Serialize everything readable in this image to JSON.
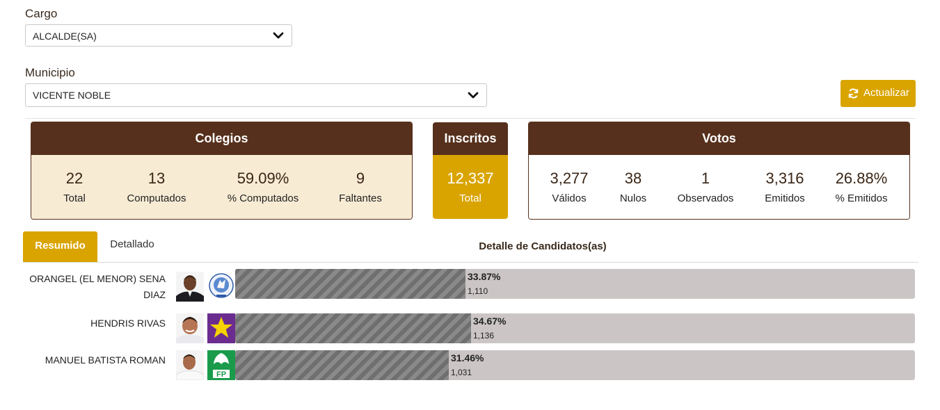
{
  "filters": {
    "cargo_label": "Cargo",
    "cargo_value": "ALCALDE(SA)",
    "municipio_label": "Municipio",
    "municipio_value": "VICENTE NOBLE",
    "refresh_label": "Actualizar"
  },
  "colegios": {
    "title": "Colegios",
    "stats": [
      {
        "value": "22",
        "caption": "Total"
      },
      {
        "value": "13",
        "caption": "Computados"
      },
      {
        "value": "59.09%",
        "caption": "% Computados"
      },
      {
        "value": "9",
        "caption": "Faltantes"
      }
    ]
  },
  "inscritos": {
    "title": "Inscritos",
    "value": "12,337",
    "caption": "Total"
  },
  "votos": {
    "title": "Votos",
    "stats": [
      {
        "value": "3,277",
        "caption": "Válidos"
      },
      {
        "value": "38",
        "caption": "Nulos"
      },
      {
        "value": "1",
        "caption": "Observados"
      },
      {
        "value": "3,316",
        "caption": "Emitidos"
      },
      {
        "value": "26.88%",
        "caption": "% Emitidos"
      }
    ]
  },
  "tabs": {
    "resumen": "Resumido",
    "detallado": "Detallado",
    "title": "Detalle de Candidatos(as)"
  },
  "candidates": [
    {
      "name_line1": "ORANGEL (EL MENOR) SENA",
      "name_line2": "DIAZ",
      "percent_label": "33.87%",
      "percent": 33.87,
      "votes": "1,110"
    },
    {
      "name_line1": "HENDRIS RIVAS",
      "name_line2": "",
      "percent_label": "34.67%",
      "percent": 34.67,
      "votes": "1,136"
    },
    {
      "name_line1": "MANUEL BATISTA ROMAN",
      "name_line2": "",
      "percent_label": "31.46%",
      "percent": 31.46,
      "votes": "1,031"
    }
  ],
  "colors": {
    "brown": "#56301c",
    "gold": "#d9a400",
    "bar_bg": "#cbc6c5",
    "prm_purple": "#6b2c8f",
    "star_yellow": "#f5d200",
    "fp_green": "#1a9b4b"
  },
  "icons": {
    "refresh": "refresh-icon",
    "chevron": "chevron-down-icon"
  },
  "party_logos": {
    "fp_text": "FP"
  }
}
